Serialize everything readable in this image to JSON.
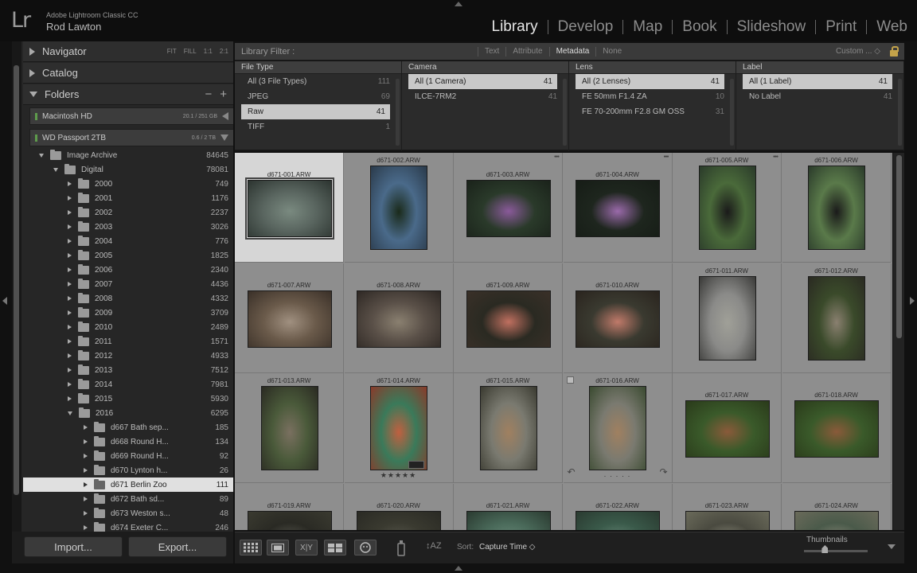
{
  "app": {
    "product": "Adobe Lightroom Classic CC",
    "logo_text": "Lr",
    "user": "Rod Lawton"
  },
  "modules": [
    {
      "label": "Library",
      "active": true
    },
    {
      "label": "Develop",
      "active": false
    },
    {
      "label": "Map",
      "active": false
    },
    {
      "label": "Book",
      "active": false
    },
    {
      "label": "Slideshow",
      "active": false
    },
    {
      "label": "Print",
      "active": false
    },
    {
      "label": "Web",
      "active": false
    }
  ],
  "left_panel": {
    "navigator": {
      "title": "Navigator",
      "zoom_options": [
        "FIT",
        "FILL",
        "1:1",
        "2:1"
      ]
    },
    "catalog": {
      "title": "Catalog"
    },
    "folders": {
      "title": "Folders",
      "remove": "−",
      "add": "+"
    },
    "volumes": [
      {
        "name": "Macintosh HD",
        "space": "20.1 / 251 GB",
        "led_color": "#5e9b4c"
      },
      {
        "name": "WD Passport 2TB",
        "space": "0.6 / 2 TB",
        "led_color": "#5e9b4c"
      }
    ],
    "tree": [
      {
        "name": "Image Archive",
        "count": "84645",
        "level": 0,
        "open": true,
        "selected": false
      },
      {
        "name": "Digital",
        "count": "78081",
        "level": 1,
        "open": true,
        "selected": false
      },
      {
        "name": "2000",
        "count": "749",
        "level": 2,
        "open": false,
        "selected": false
      },
      {
        "name": "2001",
        "count": "1176",
        "level": 2,
        "open": false,
        "selected": false
      },
      {
        "name": "2002",
        "count": "2237",
        "level": 2,
        "open": false,
        "selected": false
      },
      {
        "name": "2003",
        "count": "3026",
        "level": 2,
        "open": false,
        "selected": false
      },
      {
        "name": "2004",
        "count": "776",
        "level": 2,
        "open": false,
        "selected": false
      },
      {
        "name": "2005",
        "count": "1825",
        "level": 2,
        "open": false,
        "selected": false
      },
      {
        "name": "2006",
        "count": "2340",
        "level": 2,
        "open": false,
        "selected": false
      },
      {
        "name": "2007",
        "count": "4436",
        "level": 2,
        "open": false,
        "selected": false
      },
      {
        "name": "2008",
        "count": "4332",
        "level": 2,
        "open": false,
        "selected": false
      },
      {
        "name": "2009",
        "count": "3709",
        "level": 2,
        "open": false,
        "selected": false
      },
      {
        "name": "2010",
        "count": "2489",
        "level": 2,
        "open": false,
        "selected": false
      },
      {
        "name": "2011",
        "count": "1571",
        "level": 2,
        "open": false,
        "selected": false
      },
      {
        "name": "2012",
        "count": "4933",
        "level": 2,
        "open": false,
        "selected": false
      },
      {
        "name": "2013",
        "count": "7512",
        "level": 2,
        "open": false,
        "selected": false
      },
      {
        "name": "2014",
        "count": "7981",
        "level": 2,
        "open": false,
        "selected": false
      },
      {
        "name": "2015",
        "count": "5930",
        "level": 2,
        "open": false,
        "selected": false
      },
      {
        "name": "2016",
        "count": "6295",
        "level": 2,
        "open": true,
        "selected": false
      },
      {
        "name": "d667 Bath sep...",
        "count": "185",
        "level": 3,
        "open": false,
        "selected": false
      },
      {
        "name": "d668 Round H...",
        "count": "134",
        "level": 3,
        "open": false,
        "selected": false
      },
      {
        "name": "d669 Round H...",
        "count": "92",
        "level": 3,
        "open": false,
        "selected": false
      },
      {
        "name": "d670 Lynton h...",
        "count": "26",
        "level": 3,
        "open": false,
        "selected": false
      },
      {
        "name": "d671 Berlin Zoo",
        "count": "111",
        "level": 3,
        "open": false,
        "selected": true
      },
      {
        "name": "d672 Bath sd...",
        "count": "89",
        "level": 3,
        "open": false,
        "selected": false
      },
      {
        "name": "d673 Weston s...",
        "count": "48",
        "level": 3,
        "open": false,
        "selected": false
      },
      {
        "name": "d674 Exeter C...",
        "count": "246",
        "level": 3,
        "open": false,
        "selected": false
      }
    ],
    "import_label": "Import...",
    "export_label": "Export..."
  },
  "filter_bar": {
    "title": "Library Filter :",
    "options": [
      {
        "label": "Text",
        "active": false
      },
      {
        "label": "Attribute",
        "active": false
      },
      {
        "label": "Metadata",
        "active": true
      },
      {
        "label": "None",
        "active": false
      }
    ],
    "preset": "Custom ... ◇"
  },
  "metadata_columns": [
    {
      "header": "File Type",
      "rows": [
        {
          "label": "All (3 File Types)",
          "count": "111",
          "selected": false
        },
        {
          "label": "JPEG",
          "count": "69",
          "selected": false
        },
        {
          "label": "Raw",
          "count": "41",
          "selected": true
        },
        {
          "label": "TIFF",
          "count": "1",
          "selected": false
        }
      ]
    },
    {
      "header": "Camera",
      "rows": [
        {
          "label": "All (1 Camera)",
          "count": "41",
          "selected": true
        },
        {
          "label": "ILCE-7RM2",
          "count": "41",
          "selected": false
        }
      ]
    },
    {
      "header": "Lens",
      "rows": [
        {
          "label": "All (2 Lenses)",
          "count": "41",
          "selected": true
        },
        {
          "label": "FE 50mm F1.4 ZA",
          "count": "10",
          "selected": false
        },
        {
          "label": "FE 70-200mm F2.8 GM OSS",
          "count": "31",
          "selected": false
        }
      ]
    },
    {
      "header": "Label",
      "rows": [
        {
          "label": "All (1 Label)",
          "count": "41",
          "selected": true
        },
        {
          "label": "No Label",
          "count": "41",
          "selected": false
        }
      ]
    }
  ],
  "grid": {
    "cells": [
      {
        "filename": "d671-001.ARW",
        "orientation": "landscape",
        "colors": [
          "#5a6660",
          "#2c3430",
          "#7a8a80"
        ],
        "selected": true,
        "stars": "",
        "dots": false
      },
      {
        "filename": "d671-002.ARW",
        "orientation": "portrait",
        "colors": [
          "#4a6a8a",
          "#2a3a4a",
          "#1a2a1a"
        ],
        "selected": false,
        "stars": "",
        "dots": false
      },
      {
        "filename": "d671-003.ARW",
        "orientation": "landscape",
        "colors": [
          "#2a3a2a",
          "#1a221a",
          "#8a5a9a"
        ],
        "selected": false,
        "stars": "",
        "dots": true
      },
      {
        "filename": "d671-004.ARW",
        "orientation": "landscape",
        "colors": [
          "#1e261e",
          "#161c16",
          "#9a6aaa"
        ],
        "selected": false,
        "stars": "",
        "dots": true
      },
      {
        "filename": "d671-005.ARW",
        "orientation": "portrait",
        "colors": [
          "#4a6a3a",
          "#2a3a2a",
          "#1a1a1a"
        ],
        "selected": false,
        "stars": "",
        "dots": true
      },
      {
        "filename": "d671-006.ARW",
        "orientation": "portrait",
        "colors": [
          "#5a7a4a",
          "#2a3a2a",
          "#1a1a1a"
        ],
        "selected": false,
        "stars": "",
        "dots": false
      },
      {
        "filename": "d671-007.ARW",
        "orientation": "landscape",
        "colors": [
          "#6a5a4a",
          "#3a3028",
          "#a09080"
        ],
        "selected": false,
        "stars": "",
        "dots": false
      },
      {
        "filename": "d671-008.ARW",
        "orientation": "landscape",
        "colors": [
          "#5a5048",
          "#2e2824",
          "#8a8070"
        ],
        "selected": false,
        "stars": "",
        "dots": false
      },
      {
        "filename": "d671-009.ARW",
        "orientation": "landscape",
        "colors": [
          "#2a2a22",
          "#3a3028",
          "#c07060"
        ],
        "selected": false,
        "stars": "",
        "dots": false
      },
      {
        "filename": "d671-010.ARW",
        "orientation": "landscape",
        "colors": [
          "#3a3a30",
          "#2a241e",
          "#c07a6a"
        ],
        "selected": false,
        "stars": "",
        "dots": false
      },
      {
        "filename": "d671-011.ARW",
        "orientation": "portrait",
        "colors": [
          "#8a8a88",
          "#3a3a38",
          "#a0a098"
        ],
        "selected": false,
        "stars": "",
        "dots": false
      },
      {
        "filename": "d671-012.ARW",
        "orientation": "portrait",
        "colors": [
          "#3a4a2a",
          "#2a2a22",
          "#8a8070"
        ],
        "selected": false,
        "stars": "",
        "dots": false
      },
      {
        "filename": "d671-013.ARW",
        "orientation": "portrait",
        "colors": [
          "#4a5a3a",
          "#2a2a22",
          "#7a7060"
        ],
        "selected": false,
        "stars": "",
        "dots": false
      },
      {
        "filename": "d671-014.ARW",
        "orientation": "portrait",
        "colors": [
          "#3a7a5a",
          "#8a3a2a",
          "#c06040"
        ],
        "selected": false,
        "stars": "★★★★★",
        "dots": false
      },
      {
        "filename": "d671-015.ARW",
        "orientation": "portrait",
        "colors": [
          "#7a7a70",
          "#3a3a30",
          "#a08060"
        ],
        "selected": false,
        "stars": "",
        "dots": false
      },
      {
        "filename": "d671-016.ARW",
        "orientation": "portrait",
        "colors": [
          "#7a7a70",
          "#3a4a30",
          "#a08060"
        ],
        "selected": false,
        "stars": "· · · · ·",
        "dots": false,
        "hover": true
      },
      {
        "filename": "d671-017.ARW",
        "orientation": "landscape",
        "colors": [
          "#3a5a2a",
          "#2a3a1a",
          "#8a5a3a"
        ],
        "selected": false,
        "stars": "",
        "dots": false
      },
      {
        "filename": "d671-018.ARW",
        "orientation": "landscape",
        "colors": [
          "#3a5a2a",
          "#2a3a1a",
          "#8a5a3a"
        ],
        "selected": false,
        "stars": "",
        "dots": false
      },
      {
        "filename": "d671-019.ARW",
        "orientation": "landscape",
        "colors": [
          "#2a2a24",
          "#3a3a30",
          "#5a5a50"
        ],
        "selected": false,
        "stars": "",
        "dots": false
      },
      {
        "filename": "d671-020.ARW",
        "orientation": "landscape",
        "colors": [
          "#3a3a30",
          "#2a2a24",
          "#5a5a50"
        ],
        "selected": false,
        "stars": "",
        "dots": false
      },
      {
        "filename": "d671-021.ARW",
        "orientation": "landscape",
        "colors": [
          "#4a6a5a",
          "#2a3a30",
          "#6a8a7a"
        ],
        "selected": false,
        "stars": "",
        "dots": false
      },
      {
        "filename": "d671-022.ARW",
        "orientation": "landscape",
        "colors": [
          "#3a5a4a",
          "#2a3a30",
          "#6a8a7a"
        ],
        "selected": false,
        "stars": "",
        "dots": false
      },
      {
        "filename": "d671-023.ARW",
        "orientation": "landscape",
        "colors": [
          "#4a4a40",
          "#6a6a5a",
          "#8a8a7a"
        ],
        "selected": false,
        "stars": "",
        "dots": false
      },
      {
        "filename": "d671-024.ARW",
        "orientation": "landscape",
        "colors": [
          "#4a5a4a",
          "#6a6a5a",
          "#8a8a7a"
        ],
        "selected": false,
        "stars": "",
        "dots": false
      }
    ]
  },
  "toolbar": {
    "sort_label": "Sort:",
    "sort_value": "Capture Time ◇",
    "thumbnails_label": "Thumbnails",
    "thumbnail_size": 0.33,
    "view_buttons": [
      "grid-view",
      "loupe-view",
      "compare-view",
      "survey-view",
      "people-view"
    ],
    "compare_label": "X|Y",
    "sort_icon_label": "↕AZ"
  }
}
